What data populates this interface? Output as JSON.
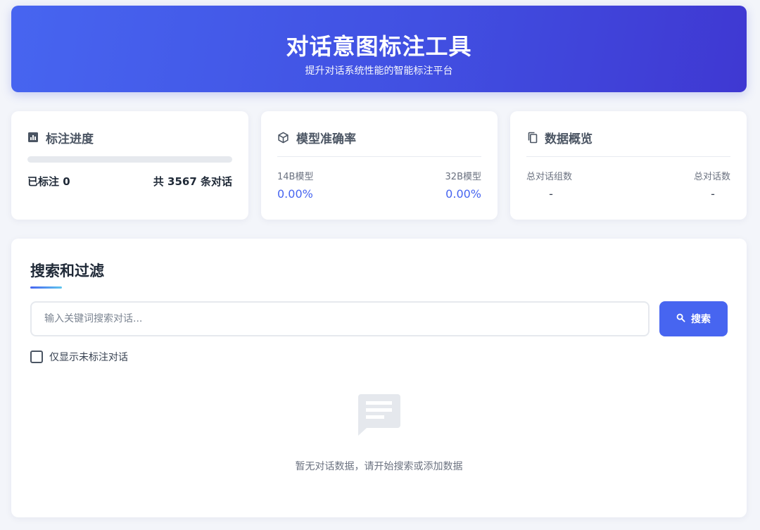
{
  "header": {
    "title": "对话意图标注工具",
    "subtitle": "提升对话系统性能的智能标注平台"
  },
  "progress": {
    "icon": "bar-chart-icon",
    "title": "标注进度",
    "fraction": 0,
    "labeled_text": "已标注 0",
    "total_text": "共 3567 条对话"
  },
  "accuracy": {
    "icon": "cube-icon",
    "title": "模型准确率",
    "model_a_label": "14B模型",
    "model_a_value": "0.00%",
    "model_b_label": "32B模型",
    "model_b_value": "0.00%"
  },
  "overview": {
    "icon": "copy-icon",
    "title": "数据概览",
    "groups_label": "总对话组数",
    "groups_value": "-",
    "total_label": "总对话数",
    "total_value": "-"
  },
  "search": {
    "title": "搜索和过滤",
    "placeholder": "输入关键词搜索对话...",
    "value": "",
    "button_label": "搜索",
    "button_icon": "search-icon",
    "filter_label": "仅显示未标注对话",
    "filter_checked": false
  },
  "empty_state": {
    "icon": "chat-message-icon",
    "text": "暂无对话数据，请开始搜索或添加数据"
  },
  "colors": {
    "accent": "#4765f0",
    "header_gradient_start": "#4765f0",
    "header_gradient_end": "#3f38d2"
  }
}
